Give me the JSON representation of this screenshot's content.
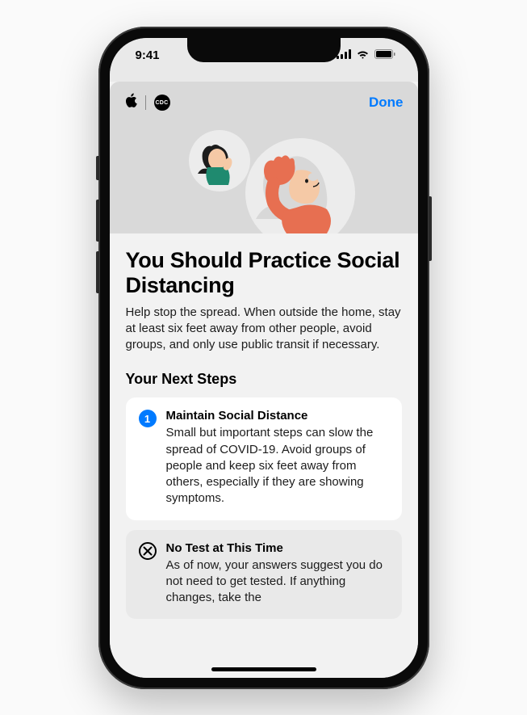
{
  "status": {
    "time": "9:41"
  },
  "header": {
    "done_label": "Done",
    "cdc_label": "CDC"
  },
  "main": {
    "title": "You Should Practice Social Distancing",
    "description": "Help stop the spread. When outside the home, stay at least six feet away from other people, avoid groups, and only use public transit if necessary.",
    "next_steps_label": "Your Next Steps"
  },
  "steps": [
    {
      "number": "1",
      "title": "Maintain Social Distance",
      "description": "Small but important steps can slow the spread of COVID-19. Avoid groups of people and keep six feet away from others, especially if they are showing symptoms."
    },
    {
      "title": "No Test at This Time",
      "description": "As of now, your answers suggest you do not need to get tested. If anything changes, take the"
    }
  ]
}
